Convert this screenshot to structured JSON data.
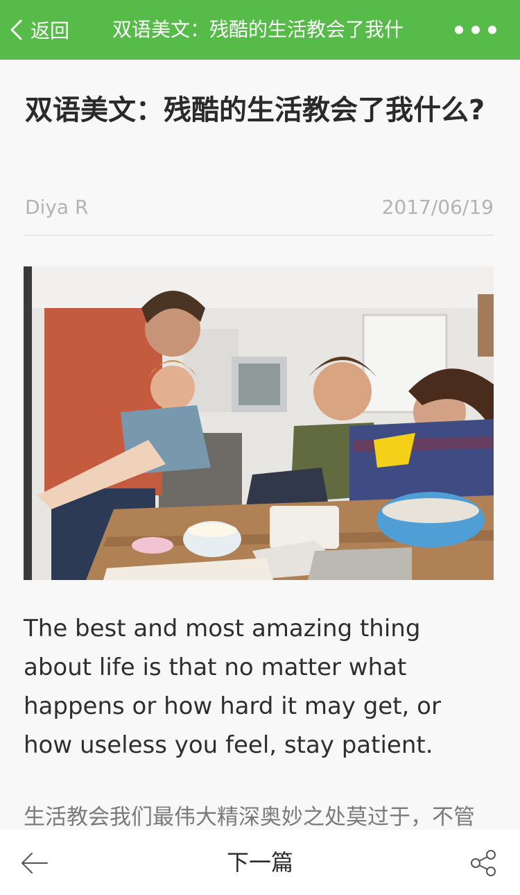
{
  "navbar": {
    "back_label": "返回",
    "title": "双语美文：残酷的生活教会了我什",
    "back_icon": "chevron-left-icon",
    "more_icon": "more-dots-icon",
    "bg_color": "#56bb48"
  },
  "article": {
    "title": "双语美文：残酷的生活教会了我什么?",
    "author": "Diya R",
    "date": "2017/06/19",
    "paragraph_en": "The best and most amazing thing about life is that no matter what happens or how hard it may get, or how useless you feel, stay patient.",
    "paragraph_zh": "生活教会我们最伟大精深奥妙之处莫过于，不管"
  },
  "bottom_bar": {
    "back_icon": "arrow-left-icon",
    "next_label": "下一篇",
    "share_icon": "share-icon"
  }
}
